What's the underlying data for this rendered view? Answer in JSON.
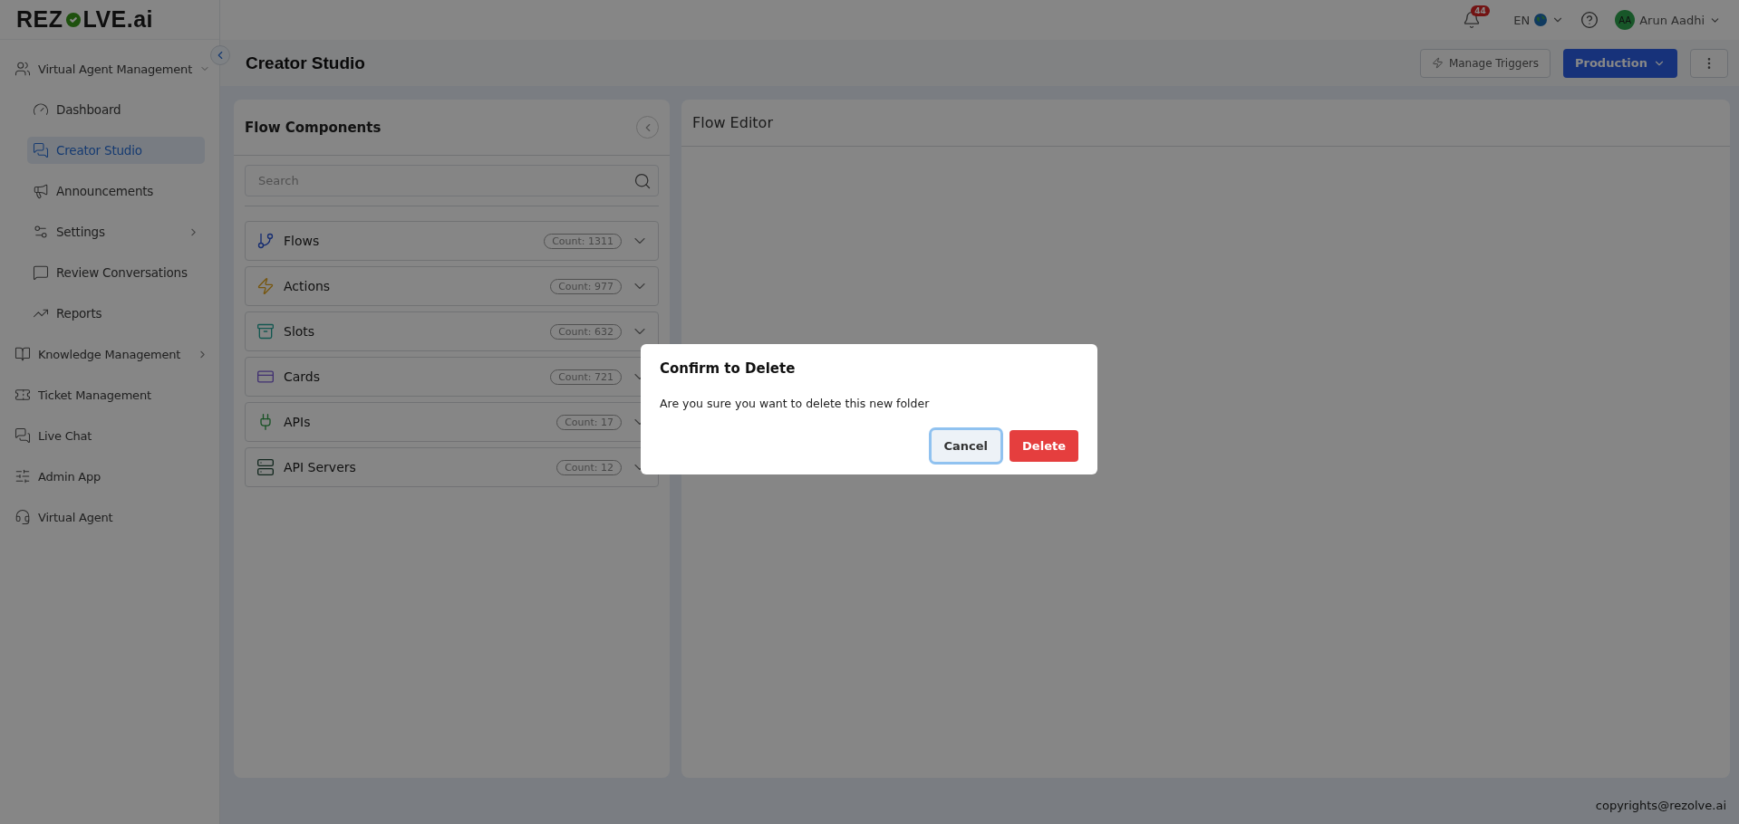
{
  "logo": {
    "parts": [
      "REZ",
      "LVE.ai"
    ]
  },
  "topbar": {
    "notifications": "44",
    "language": "EN",
    "user": {
      "initials": "AA",
      "name": "Arun Aadhi"
    }
  },
  "sidebar": {
    "items": [
      {
        "label": "Virtual Agent Management",
        "selected": false,
        "expandable": true,
        "expanded": true,
        "children": [
          {
            "label": "Dashboard",
            "selected": false,
            "expandable": false
          },
          {
            "label": "Creator Studio",
            "selected": true,
            "expandable": false
          },
          {
            "label": "Announcements",
            "selected": false,
            "expandable": false
          },
          {
            "label": "Settings",
            "selected": false,
            "expandable": true,
            "expanded": false
          },
          {
            "label": "Review Conversations",
            "selected": false,
            "expandable": false
          },
          {
            "label": "Reports",
            "selected": false,
            "expandable": false
          }
        ]
      },
      {
        "label": "Knowledge Management",
        "selected": false,
        "expandable": true,
        "expanded": false
      },
      {
        "label": "Ticket Management",
        "selected": false,
        "expandable": false
      },
      {
        "label": "Live Chat",
        "selected": false,
        "expandable": false
      },
      {
        "label": "Admin App",
        "selected": false,
        "expandable": false
      },
      {
        "label": "Virtual Agent",
        "selected": false,
        "expandable": false
      }
    ]
  },
  "page": {
    "title": "Creator Studio",
    "triggers_button": "Manage Triggers",
    "environment_button": "Production"
  },
  "components_panel": {
    "title": "Flow Components",
    "search": {
      "placeholder": "Search"
    },
    "items": [
      {
        "label": "Flows",
        "count": "Count: 1311"
      },
      {
        "label": "Actions",
        "count": "Count: 977"
      },
      {
        "label": "Slots",
        "count": "Count: 632"
      },
      {
        "label": "Cards",
        "count": "Count: 721"
      },
      {
        "label": "APIs",
        "count": "Count: 17"
      },
      {
        "label": "API Servers",
        "count": "Count: 12"
      }
    ]
  },
  "editor": {
    "title": "Flow Editor"
  },
  "dialog": {
    "title": "Confirm to Delete",
    "message": "Are you sure you want to delete this new folder",
    "buttons": [
      {
        "label": "Cancel",
        "kind": "secondary",
        "focused": true
      },
      {
        "label": "Delete",
        "kind": "danger",
        "focused": false
      }
    ]
  },
  "footer": {
    "text": "copyrights@rezolve.ai"
  }
}
